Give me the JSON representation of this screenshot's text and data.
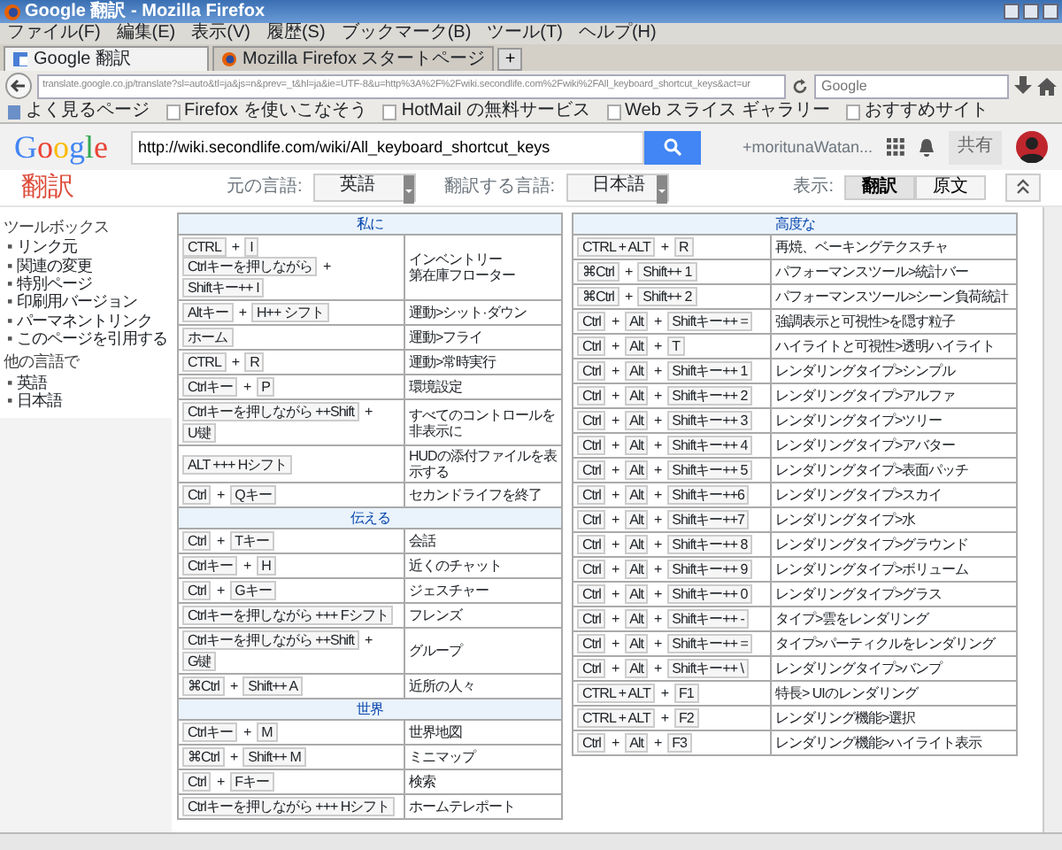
{
  "window": {
    "title": "Google 翻訳 - Mozilla Firefox"
  },
  "menu": [
    "ファイル(F)",
    "編集(E)",
    "表示(V)",
    "履歴(S)",
    "ブックマーク(B)",
    "ツール(T)",
    "ヘルプ(H)"
  ],
  "tabs": [
    {
      "label": "Google 翻訳",
      "selected": true
    },
    {
      "label": "Mozilla Firefox スタートページ",
      "selected": false
    }
  ],
  "new_tab": "+",
  "address": {
    "value": "translate.google.co.jp/translate?sl=auto&tl=ja&js=n&prev=_t&hl=ja&ie=UTF-8&u=http%3A%2F%2Fwiki.secondlife.com%2Fwiki%2FAll_keyboard_shortcut_keys&act=ur"
  },
  "browser_search": {
    "placeholder": "Google"
  },
  "bookmarks": [
    "よく見るページ",
    "Firefox を使いこなそう",
    "HotMail の無料サービス",
    "Web スライス ギャラリー",
    "おすすめサイト"
  ],
  "google_bar": {
    "logo": "Google",
    "query": "http://wiki.secondlife.com/wiki/All_keyboard_shortcut_keys",
    "user": "+moritunaWatan...",
    "share": "共有"
  },
  "translate_bar": {
    "title": "翻訳",
    "source_label": "元の言語:",
    "source": "英語",
    "target_label": "翻訳する言語:",
    "target": "日本語",
    "view_label": "表示:",
    "view_options": [
      {
        "label": "翻訳",
        "selected": true
      },
      {
        "label": "原文",
        "selected": false
      }
    ]
  },
  "sidebar": {
    "bullet": "▪",
    "sections": [
      {
        "heading": "ツールボックス",
        "links": [
          "リンク元",
          "関連の変更",
          "特別ページ",
          "印刷用バージョン",
          "パーマネントリンク",
          "このページを引用する"
        ]
      },
      {
        "heading": "他の言語で",
        "links": [
          "英語",
          "日本語"
        ]
      }
    ]
  },
  "tables": [
    {
      "rows": [
        {
          "kind": "section",
          "title": "私に"
        },
        {
          "kind": "shortcut",
          "keys": [
            [
              "CTRL",
              "+",
              "I"
            ],
            [
              "Ctrlキーを押しながら",
              "+",
              "Shiftキー++ I"
            ]
          ],
          "actions": [
            "インベントリー",
            "第在庫フローター"
          ]
        },
        {
          "kind": "shortcut",
          "keys": [
            [
              "Altキー",
              "+",
              "H++ シフト"
            ]
          ],
          "actions": [
            "運動>シット·ダウン"
          ]
        },
        {
          "kind": "shortcut",
          "keys": [
            [
              "ホーム"
            ]
          ],
          "actions": [
            "運動>フライ"
          ]
        },
        {
          "kind": "shortcut",
          "keys": [
            [
              "CTRL",
              "+",
              "R"
            ]
          ],
          "actions": [
            "運動>常時実行"
          ]
        },
        {
          "kind": "shortcut",
          "keys": [
            [
              "Ctrlキー",
              "+",
              "P"
            ]
          ],
          "actions": [
            "環境設定"
          ]
        },
        {
          "kind": "shortcut",
          "keys": [
            [
              "Ctrlキーを押しながら ++Shift",
              "+",
              "U键"
            ]
          ],
          "actions": [
            "すべてのコントロールを非表示に"
          ]
        },
        {
          "kind": "shortcut",
          "keys": [
            [
              "ALT +++ Hシフト"
            ]
          ],
          "actions": [
            "HUDの添付ファイルを表示する"
          ]
        },
        {
          "kind": "shortcut",
          "keys": [
            [
              "Ctrl",
              "+",
              "Qキー"
            ]
          ],
          "actions": [
            "セカンドライフを終了"
          ]
        },
        {
          "kind": "section",
          "title": "伝える"
        },
        {
          "kind": "shortcut",
          "keys": [
            [
              "Ctrl",
              "+",
              "Tキー"
            ]
          ],
          "actions": [
            "会話"
          ]
        },
        {
          "kind": "shortcut",
          "keys": [
            [
              "Ctrlキー",
              "+",
              "H"
            ]
          ],
          "actions": [
            "近くのチャット"
          ]
        },
        {
          "kind": "shortcut",
          "keys": [
            [
              "Ctrl",
              "+",
              "Gキー"
            ]
          ],
          "actions": [
            "ジェスチャー"
          ]
        },
        {
          "kind": "shortcut",
          "keys": [
            [
              "Ctrlキーを押しながら +++ Fシフト"
            ]
          ],
          "actions": [
            "フレンズ"
          ]
        },
        {
          "kind": "shortcut",
          "keys": [
            [
              "Ctrlキーを押しながら ++Shift",
              "+",
              "G键"
            ]
          ],
          "actions": [
            "グループ"
          ]
        },
        {
          "kind": "shortcut",
          "keys": [
            [
              "⌘Ctrl",
              "+",
              "Shift++ A"
            ]
          ],
          "actions": [
            "近所の人々"
          ]
        },
        {
          "kind": "section",
          "title": "世界"
        },
        {
          "kind": "shortcut",
          "keys": [
            [
              "Ctrlキー",
              "+",
              "M"
            ]
          ],
          "actions": [
            "世界地図"
          ]
        },
        {
          "kind": "shortcut",
          "keys": [
            [
              "⌘Ctrl",
              "+",
              "Shift++ M"
            ]
          ],
          "actions": [
            "ミニマップ"
          ]
        },
        {
          "kind": "shortcut",
          "keys": [
            [
              "Ctrl",
              "+",
              "Fキー"
            ]
          ],
          "actions": [
            "検索"
          ]
        },
        {
          "kind": "shortcut",
          "keys": [
            [
              "Ctrlキーを押しながら +++ Hシフト"
            ]
          ],
          "actions": [
            "ホームテレポート"
          ]
        }
      ]
    },
    {
      "rows": [
        {
          "kind": "section",
          "title": "高度な"
        },
        {
          "kind": "shortcut",
          "keys": [
            [
              "CTRL + ALT",
              "+",
              "R"
            ]
          ],
          "actions": [
            "再焼、ベーキングテクスチャ"
          ]
        },
        {
          "kind": "shortcut",
          "keys": [
            [
              "⌘Ctrl",
              "+",
              "Shift++ 1"
            ]
          ],
          "actions": [
            "パフォーマンスツール>統計バー"
          ]
        },
        {
          "kind": "shortcut",
          "keys": [
            [
              "⌘Ctrl",
              "+",
              "Shift++ 2"
            ]
          ],
          "actions": [
            "パフォーマンスツール>シーン負荷統計"
          ]
        },
        {
          "kind": "shortcut",
          "keys": [
            [
              "Ctrl",
              "+",
              "Alt",
              "+",
              "Shiftキー++ ="
            ]
          ],
          "actions": [
            "強調表示と可視性>を隠す粒子"
          ]
        },
        {
          "kind": "shortcut",
          "keys": [
            [
              "Ctrl",
              "+",
              "Alt",
              "+",
              "T"
            ]
          ],
          "actions": [
            "ハイライトと可視性>透明ハイライト"
          ]
        },
        {
          "kind": "shortcut",
          "keys": [
            [
              "Ctrl",
              "+",
              "Alt",
              "+",
              "Shiftキー++ 1"
            ]
          ],
          "actions": [
            "レンダリングタイプ>シンプル"
          ]
        },
        {
          "kind": "shortcut",
          "keys": [
            [
              "Ctrl",
              "+",
              "Alt",
              "+",
              "Shiftキー++ 2"
            ]
          ],
          "actions": [
            "レンダリングタイプ>アルファ"
          ]
        },
        {
          "kind": "shortcut",
          "keys": [
            [
              "Ctrl",
              "+",
              "Alt",
              "+",
              "Shiftキー++ 3"
            ]
          ],
          "actions": [
            "レンダリングタイプ>ツリー"
          ]
        },
        {
          "kind": "shortcut",
          "keys": [
            [
              "Ctrl",
              "+",
              "Alt",
              "+",
              "Shiftキー++ 4"
            ]
          ],
          "actions": [
            "レンダリングタイプ>アバター"
          ]
        },
        {
          "kind": "shortcut",
          "keys": [
            [
              "Ctrl",
              "+",
              "Alt",
              "+",
              "Shiftキー++ 5"
            ]
          ],
          "actions": [
            "レンダリングタイプ>表面パッチ"
          ]
        },
        {
          "kind": "shortcut",
          "keys": [
            [
              "Ctrl",
              "+",
              "Alt",
              "+",
              "Shiftキー++6"
            ]
          ],
          "actions": [
            "レンダリングタイプ>スカイ"
          ]
        },
        {
          "kind": "shortcut",
          "keys": [
            [
              "Ctrl",
              "+",
              "Alt",
              "+",
              "Shiftキー++7"
            ]
          ],
          "actions": [
            "レンダリングタイプ>水"
          ]
        },
        {
          "kind": "shortcut",
          "keys": [
            [
              "Ctrl",
              "+",
              "Alt",
              "+",
              "Shiftキー++ 8"
            ]
          ],
          "actions": [
            "レンダリングタイプ>グラウンド"
          ]
        },
        {
          "kind": "shortcut",
          "keys": [
            [
              "Ctrl",
              "+",
              "Alt",
              "+",
              "Shiftキー++ 9"
            ]
          ],
          "actions": [
            "レンダリングタイプ>ボリューム"
          ]
        },
        {
          "kind": "shortcut",
          "keys": [
            [
              "Ctrl",
              "+",
              "Alt",
              "+",
              "Shiftキー++ 0"
            ]
          ],
          "actions": [
            "レンダリングタイプ>グラス"
          ]
        },
        {
          "kind": "shortcut",
          "keys": [
            [
              "Ctrl",
              "+",
              "Alt",
              "+",
              "Shiftキー++ -"
            ]
          ],
          "actions": [
            "タイプ>雲をレンダリング"
          ]
        },
        {
          "kind": "shortcut",
          "keys": [
            [
              "Ctrl",
              "+",
              "Alt",
              "+",
              "Shiftキー++ ="
            ]
          ],
          "actions": [
            "タイプ>パーティクルをレンダリング"
          ]
        },
        {
          "kind": "shortcut",
          "keys": [
            [
              "Ctrl",
              "+",
              "Alt",
              "+",
              "Shiftキー++ \\"
            ]
          ],
          "actions": [
            "レンダリングタイプ>バンプ"
          ]
        },
        {
          "kind": "shortcut",
          "keys": [
            [
              "CTRL + ALT",
              "+",
              "F1"
            ]
          ],
          "actions": [
            "特長> UIのレンダリング"
          ]
        },
        {
          "kind": "shortcut",
          "keys": [
            [
              "CTRL + ALT",
              "+",
              "F2"
            ]
          ],
          "actions": [
            "レンダリング機能>選択"
          ]
        },
        {
          "kind": "shortcut",
          "keys": [
            [
              "Ctrl",
              "+",
              "Alt",
              "+",
              "F3"
            ]
          ],
          "actions": [
            "レンダリング機能>ハイライト表示"
          ]
        }
      ]
    }
  ]
}
